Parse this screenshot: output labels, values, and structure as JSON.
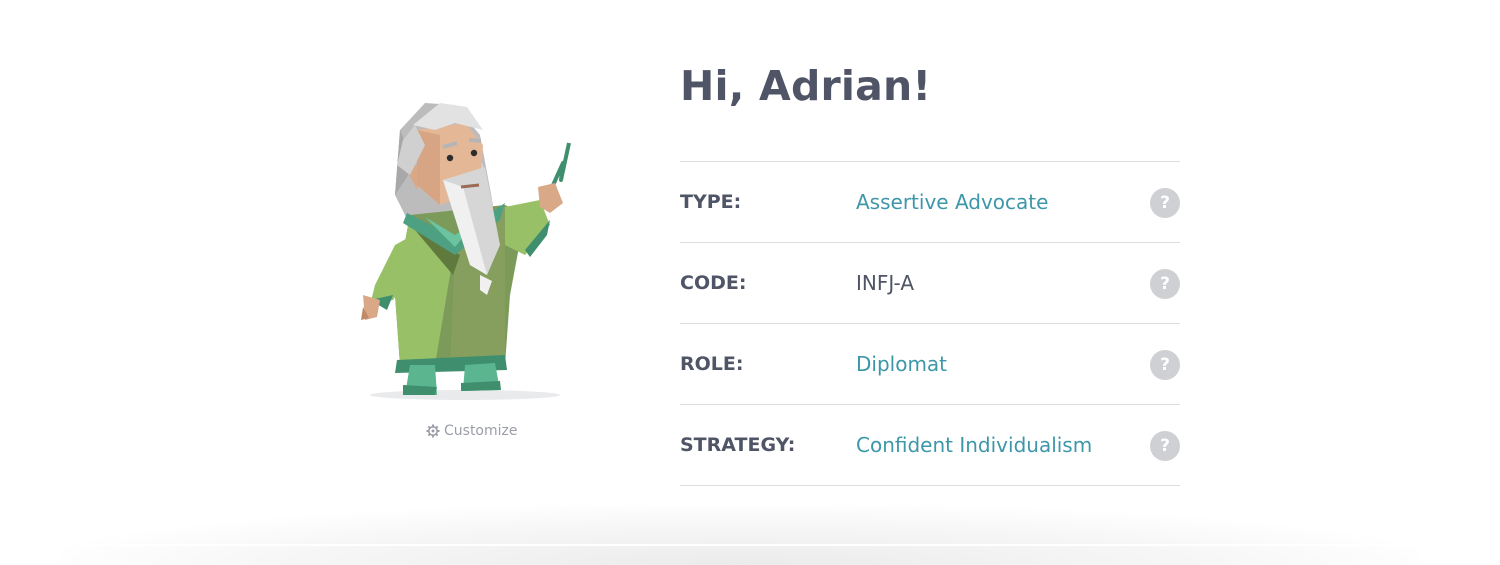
{
  "greeting": "Hi, Adrian!",
  "avatar": {
    "customize_label": "Customize",
    "icon": "gear-icon"
  },
  "profile": {
    "rows": [
      {
        "label": "TYPE:",
        "value": "Assertive Advocate",
        "link": true
      },
      {
        "label": "CODE:",
        "value": "INFJ-A",
        "link": false
      },
      {
        "label": "ROLE:",
        "value": "Diplomat",
        "link": true
      },
      {
        "label": "STRATEGY:",
        "value": "Confident Individualism",
        "link": true
      }
    ],
    "help_symbol": "?"
  },
  "colors": {
    "heading": "#4f5566",
    "link": "#3d97a9",
    "help": "#cfd0d4",
    "divider": "#dcdde0"
  }
}
